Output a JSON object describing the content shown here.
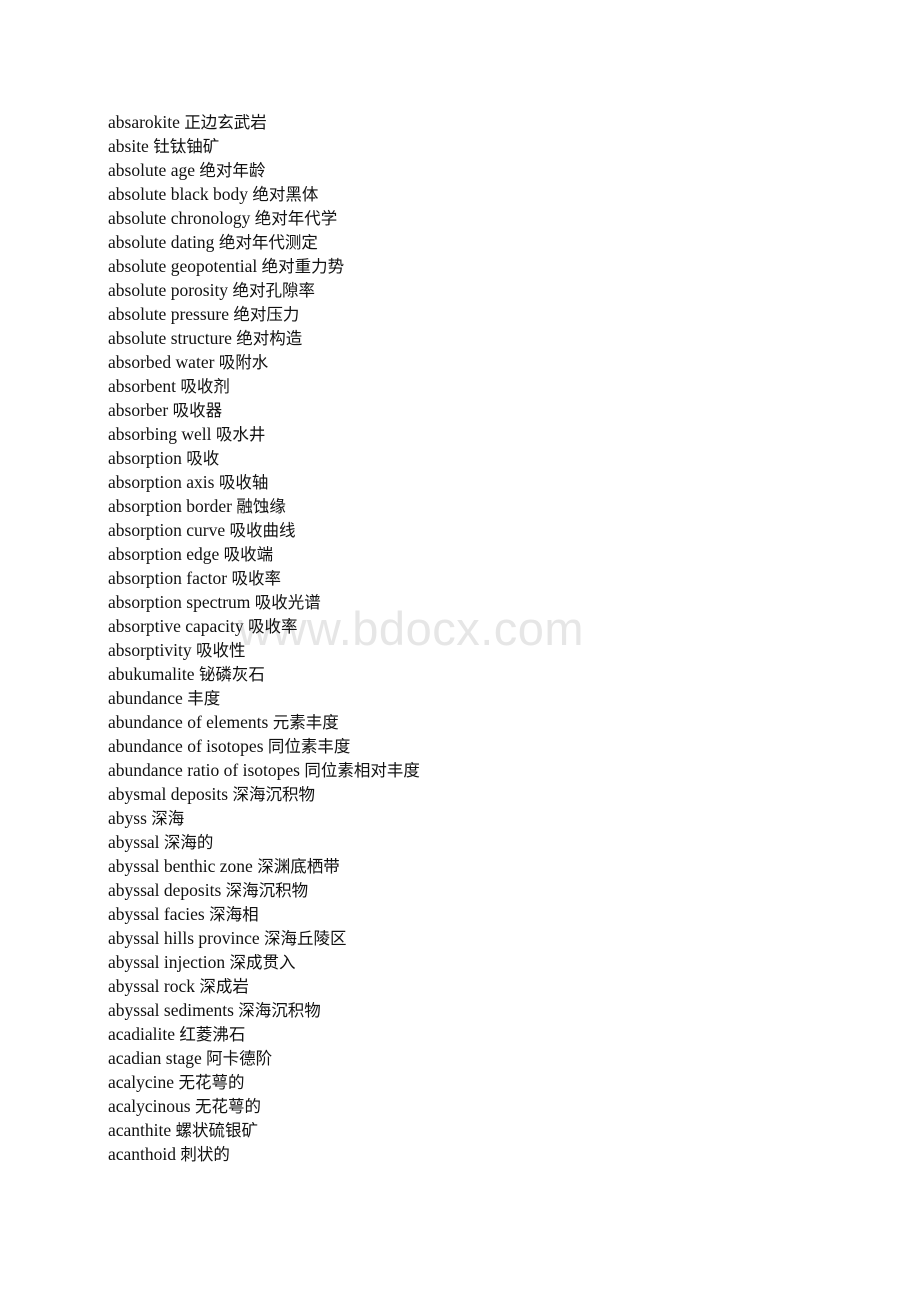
{
  "document": {
    "type": "bilingual-glossary-page",
    "language_pair": "English-Chinese",
    "page_background": "#ffffff",
    "text_color": "#111111"
  },
  "watermark": {
    "text": "www.bdocx.com",
    "color": "#e6e6e6"
  },
  "entries": [
    {
      "term": "absarokite",
      "gloss": "正边玄武岩"
    },
    {
      "term": "absite",
      "gloss": "钍钛铀矿"
    },
    {
      "term": "absolute age",
      "gloss": "绝对年龄"
    },
    {
      "term": "absolute black body",
      "gloss": "绝对黑体"
    },
    {
      "term": "absolute chronology",
      "gloss": "绝对年代学"
    },
    {
      "term": "absolute dating",
      "gloss": "绝对年代测定"
    },
    {
      "term": "absolute geopotential",
      "gloss": "绝对重力势"
    },
    {
      "term": "absolute porosity",
      "gloss": "绝对孔隙率"
    },
    {
      "term": "absolute pressure",
      "gloss": "绝对压力"
    },
    {
      "term": "absolute structure",
      "gloss": "绝对构造"
    },
    {
      "term": "absorbed water",
      "gloss": "吸附水"
    },
    {
      "term": "absorbent",
      "gloss": "吸收剂"
    },
    {
      "term": "absorber",
      "gloss": "吸收器"
    },
    {
      "term": "absorbing well",
      "gloss": "吸水井"
    },
    {
      "term": "absorption",
      "gloss": "吸收"
    },
    {
      "term": "absorption axis",
      "gloss": "吸收轴"
    },
    {
      "term": "absorption border",
      "gloss": "融蚀缘"
    },
    {
      "term": "absorption curve",
      "gloss": "吸收曲线"
    },
    {
      "term": "absorption edge",
      "gloss": "吸收端"
    },
    {
      "term": "absorption factor",
      "gloss": "吸收率"
    },
    {
      "term": "absorption spectrum",
      "gloss": "吸收光谱"
    },
    {
      "term": "absorptive capacity",
      "gloss": "吸收率"
    },
    {
      "term": "absorptivity",
      "gloss": "吸收性"
    },
    {
      "term": "abukumalite",
      "gloss": "铋磷灰石"
    },
    {
      "term": "abundance",
      "gloss": "丰度"
    },
    {
      "term": "abundance of elements",
      "gloss": "元素丰度"
    },
    {
      "term": "abundance of isotopes",
      "gloss": "同位素丰度"
    },
    {
      "term": "abundance ratio of isotopes",
      "gloss": "同位素相对丰度"
    },
    {
      "term": "abysmal deposits",
      "gloss": "深海沉积物"
    },
    {
      "term": "abyss",
      "gloss": "深海"
    },
    {
      "term": "abyssal",
      "gloss": "深海的"
    },
    {
      "term": "abyssal benthic zone",
      "gloss": "深渊底栖带"
    },
    {
      "term": "abyssal deposits",
      "gloss": "深海沉积物"
    },
    {
      "term": "abyssal facies",
      "gloss": "深海相"
    },
    {
      "term": "abyssal hills province",
      "gloss": "深海丘陵区"
    },
    {
      "term": "abyssal injection",
      "gloss": "深成贯入"
    },
    {
      "term": "abyssal rock",
      "gloss": "深成岩"
    },
    {
      "term": "abyssal sediments",
      "gloss": "深海沉积物"
    },
    {
      "term": "acadialite",
      "gloss": "红菱沸石"
    },
    {
      "term": "acadian stage",
      "gloss": "阿卡德阶"
    },
    {
      "term": "acalycine",
      "gloss": "无花萼的"
    },
    {
      "term": "acalycinous",
      "gloss": "无花萼的"
    },
    {
      "term": "acanthite",
      "gloss": "螺状硫银矿"
    },
    {
      "term": "acanthoid",
      "gloss": "刺状的"
    }
  ]
}
